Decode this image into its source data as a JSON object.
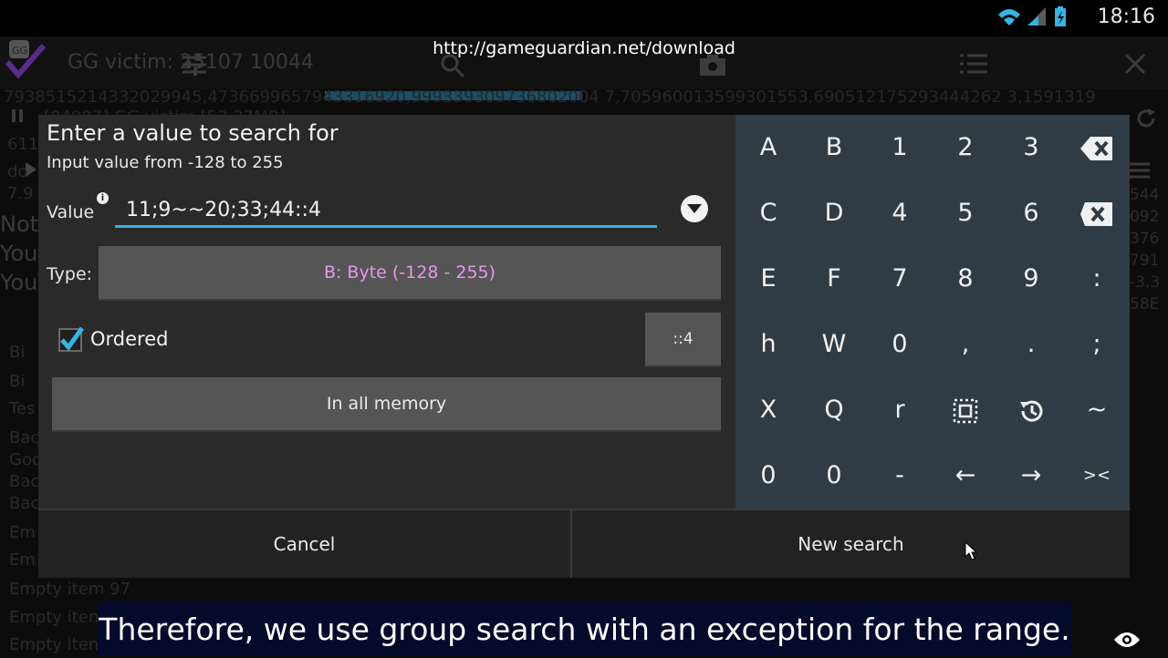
{
  "status_bar": {
    "time": "18:16"
  },
  "url_banner": "http://gameguardian.net/download",
  "background": {
    "title": "GG victim: 25107 10044",
    "hex_line": "7938515214332029945,4736699657943316920,999339309736802004 7,705960013599301553,690512175293444262 3,1591319",
    "sub_line": "[04907] GG victim [52.27MB]",
    "left_items": [
      "611",
      "do",
      "7.9",
      "Bi",
      "Bi",
      "Tes",
      "Bac",
      "Goo",
      "Bac",
      "Bac",
      "Em",
      "Em",
      "Empty item 97",
      "Empty iten",
      "Empty iten"
    ],
    "left_big": [
      "Not",
      "You",
      "You"
    ],
    "right_items": [
      "544",
      "092",
      "376",
      "791",
      "-3.3",
      "58E"
    ]
  },
  "dialog": {
    "title": "Enter a value to search for",
    "subtitle": "Input value from -128 to 255",
    "value_label": "Value",
    "value": "11;9~~20;33;44::4",
    "type_label": "Type:",
    "type_value": "B: Byte (-128 - 255)",
    "ordered_label": "Ordered",
    "ordered_checked": true,
    "step_label": "::4",
    "memory_label": "In all memory",
    "cancel_label": "Cancel",
    "new_search_label": "New search"
  },
  "keypad": {
    "rows": [
      [
        "A",
        "B",
        "1",
        "2",
        "3",
        "backspace-icon"
      ],
      [
        "C",
        "D",
        "4",
        "5",
        "6",
        "clear-icon"
      ],
      [
        "E",
        "F",
        "7",
        "8",
        "9",
        ":"
      ],
      [
        "h",
        "W",
        "0",
        ",",
        ".",
        ";"
      ],
      [
        "X",
        "Q",
        "r",
        "select-all-icon",
        "history-icon",
        "~"
      ],
      [
        "0",
        "0",
        "-",
        "←",
        "→",
        "><"
      ]
    ]
  },
  "caption": "Therefore, we use group search with an exception for the range.",
  "colors": {
    "accent": "#33b5e5",
    "type_text": "#e896e8",
    "keypad_bg": "#2f3c46",
    "dialog_bg": "#2a2a2a",
    "caption_bg": "#030a2a"
  }
}
